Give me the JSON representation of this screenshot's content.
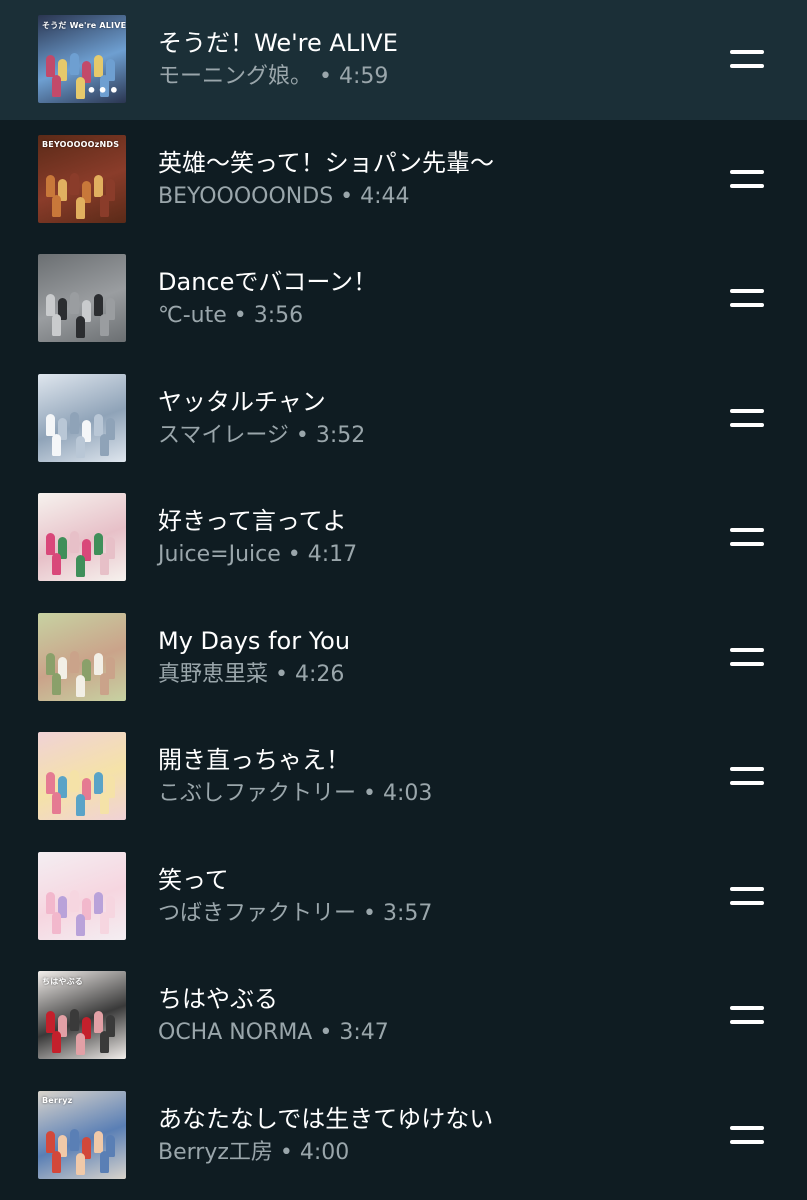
{
  "queue": {
    "items": [
      {
        "title": "そうだ！We're ALIVE",
        "subtitle": "モーニング娘。 • 4:59",
        "art_text": "そうだ We're ALIVE",
        "active": true,
        "more": "•••",
        "colors": [
          "#2a3550",
          "#c24a6a",
          "#e6c96b",
          "#6e9fd1"
        ]
      },
      {
        "title": "英雄〜笑って！ショパン先輩〜",
        "subtitle": "BEYOOOOONDS • 4:44",
        "art_text": "BEYOOOOOzNDS",
        "active": false,
        "colors": [
          "#5a2a18",
          "#c8783a",
          "#e0b060",
          "#8a3c2a"
        ]
      },
      {
        "title": "Danceでバコーン！",
        "subtitle": "℃-ute • 3:56",
        "art_text": "",
        "active": false,
        "colors": [
          "#6b6f72",
          "#c9cbcd",
          "#2b2d30",
          "#9a9da0"
        ]
      },
      {
        "title": "ヤッタルチャン",
        "subtitle": "スマイレージ • 3:52",
        "art_text": "",
        "active": false,
        "colors": [
          "#dfe6ee",
          "#f4f6f8",
          "#b9c7d6",
          "#8fa3b8"
        ]
      },
      {
        "title": "好きって言ってよ",
        "subtitle": "Juice=Juice • 4:17",
        "art_text": "",
        "active": false,
        "colors": [
          "#f6f2ee",
          "#d9487a",
          "#3f8f5a",
          "#e7c0c8"
        ]
      },
      {
        "title": "My Days for You",
        "subtitle": "真野恵里菜 • 4:26",
        "art_text": "",
        "active": false,
        "colors": [
          "#c7d2a2",
          "#8aa06a",
          "#f2efe6",
          "#caa38a"
        ]
      },
      {
        "title": "開き直っちゃえ！",
        "subtitle": "こぶしファクトリー • 4:03",
        "art_text": "",
        "active": false,
        "colors": [
          "#f0d2d6",
          "#e57a92",
          "#5aa3c7",
          "#f5e2a8"
        ]
      },
      {
        "title": "笑って",
        "subtitle": "つばきファクトリー • 3:57",
        "art_text": "",
        "active": false,
        "colors": [
          "#f4eef2",
          "#f2b8cc",
          "#b9a2d9",
          "#f6d6e0"
        ]
      },
      {
        "title": "ちはやぶる",
        "subtitle": "OCHA NORMA • 3:47",
        "art_text": "ちはやぶる",
        "active": false,
        "colors": [
          "#f3efec",
          "#c4202c",
          "#e2a0a6",
          "#3a3a3a"
        ]
      },
      {
        "title": "あなたなしでは生きてゆけない",
        "subtitle": "Berryz工房 • 4:00",
        "art_text": "Berryz",
        "active": false,
        "colors": [
          "#d9d4cc",
          "#d2483a",
          "#f0c9a8",
          "#5a7fb5"
        ]
      }
    ]
  }
}
